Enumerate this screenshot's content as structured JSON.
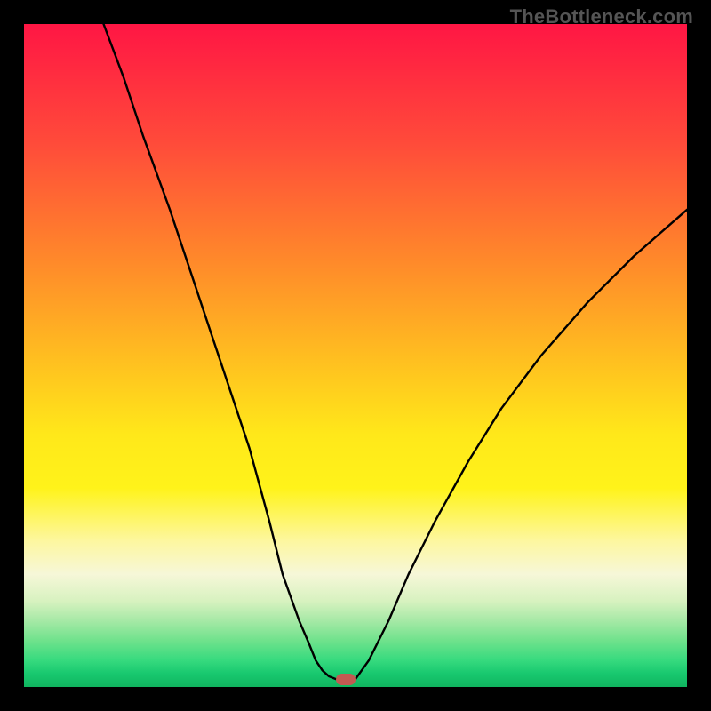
{
  "watermark": "TheBottleneck.com",
  "chart_data": {
    "type": "line",
    "title": "",
    "xlabel": "",
    "ylabel": "",
    "xlim": [
      0,
      100
    ],
    "ylim": [
      0,
      100
    ],
    "series": [
      {
        "name": "left-arm",
        "x": [
          12,
          15,
          18,
          22,
          26,
          30,
          34,
          37,
          39,
          41.5,
          43,
          44,
          45,
          46,
          47
        ],
        "values": [
          100,
          92,
          83,
          72,
          60,
          48,
          36,
          25,
          17,
          10,
          6.5,
          4,
          2.5,
          1.6,
          1.2
        ]
      },
      {
        "name": "valley-floor",
        "x": [
          47,
          48,
          49,
          50
        ],
        "values": [
          1.2,
          1.2,
          1.2,
          1.2
        ]
      },
      {
        "name": "right-arm",
        "x": [
          50,
          52,
          55,
          58,
          62,
          67,
          72,
          78,
          85,
          92,
          100
        ],
        "values": [
          1.2,
          4,
          10,
          17,
          25,
          34,
          42,
          50,
          58,
          65,
          72
        ]
      }
    ],
    "marker": {
      "x": 48.5,
      "y": 1.2,
      "color": "#c25a52"
    },
    "background": "rainbow-vertical-gradient",
    "grid": false,
    "legend": false
  }
}
